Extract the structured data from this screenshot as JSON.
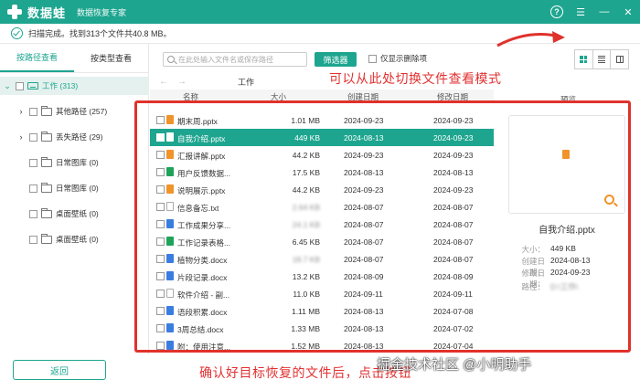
{
  "app": {
    "name": "数据蛙",
    "subtitle": "数据恢复专家"
  },
  "status": {
    "text": "扫描完成。找到313个文件共40.8 MB。"
  },
  "sidebar": {
    "tabs": [
      {
        "label": "按路径查看",
        "active": true
      },
      {
        "label": "按类型查看",
        "active": false
      }
    ],
    "root": {
      "label": "工作 (313)"
    },
    "items": [
      {
        "label": "其他路径 (257)",
        "expandable": true
      },
      {
        "label": "丢失路径 (29)",
        "expandable": true
      },
      {
        "label": "日常图库 (0)",
        "expandable": false
      },
      {
        "label": "日常图库 (0)",
        "expandable": false
      },
      {
        "label": "桌面壁纸 (0)",
        "expandable": false
      },
      {
        "label": "桌面壁纸 (0)",
        "expandable": false
      }
    ],
    "back_label": "返回"
  },
  "toolbar": {
    "search_placeholder": "在此处输入文件名或保存路径",
    "filter_label": "筛选器",
    "only_deleted_label": "仅显示删除项"
  },
  "annotations": {
    "top": "可以从此处切换文件查看模式",
    "bottom": "确认好目标恢复的文件后，点击按钮"
  },
  "watermark": "掘金技术社区 @小明助手",
  "breadcrumb": "工作",
  "columns": {
    "name": "名称",
    "size": "大小",
    "created": "创建日期",
    "modified": "修改日期"
  },
  "files": [
    {
      "name": "期末周.pptx",
      "size": "1.01 MB",
      "created": "2024-09-23",
      "modified": "2024-09-23",
      "type": "pptx",
      "selected": false
    },
    {
      "name": "自我介绍.pptx",
      "size": "449 KB",
      "created": "2024-08-13",
      "modified": "2024-09-23",
      "type": "pptx2",
      "selected": true
    },
    {
      "name": "汇报讲解.pptx",
      "size": "44.2 KB",
      "created": "2024-09-23",
      "modified": "2024-09-23",
      "type": "pptx",
      "selected": false
    },
    {
      "name": "用户反馈数据...",
      "size": "17.5 KB",
      "created": "2024-08-13",
      "modified": "2024-08-13",
      "type": "xlsx",
      "selected": false
    },
    {
      "name": "说明展示.pptx",
      "size": "44.2 KB",
      "created": "2024-09-23",
      "modified": "2024-09-23",
      "type": "pptx",
      "selected": false
    },
    {
      "name": "信息备忘.txt",
      "size": "",
      "created": "2024-08-07",
      "modified": "2024-08-07",
      "type": "txt",
      "selected": false
    },
    {
      "name": "工作成果分享...",
      "size": "",
      "created": "2024-08-07",
      "modified": "2024-08-07",
      "type": "docx",
      "selected": false
    },
    {
      "name": "工作记录表格...",
      "size": "6.45 KB",
      "created": "2024-08-07",
      "modified": "2024-08-07",
      "type": "xlsx",
      "selected": false
    },
    {
      "name": "植物分类.docx",
      "size": "",
      "created": "2024-08-07",
      "modified": "2024-08-07",
      "type": "docx",
      "selected": false
    },
    {
      "name": "片段记录.docx",
      "size": "13.2 KB",
      "created": "2024-08-09",
      "modified": "2024-08-09",
      "type": "docx",
      "selected": false
    },
    {
      "name": "软件介绍 - 副...",
      "size": "11.0 KB",
      "created": "2024-09-11",
      "modified": "2024-09-11",
      "type": "docx",
      "selected": false
    },
    {
      "name": "语段积累.docx",
      "size": "1.11 MB",
      "created": "2024-08-13",
      "modified": "2024-07-08",
      "type": "docx",
      "selected": false
    },
    {
      "name": "3周总结.docx",
      "size": "1.33 MB",
      "created": "2024-08-13",
      "modified": "2024-07-02",
      "type": "docx",
      "selected": false
    },
    {
      "name": "附：使用注意...",
      "size": "1.52 MB",
      "created": "2024-08-13",
      "modified": "2024-07-04",
      "type": "docx",
      "selected": false
    }
  ],
  "preview": {
    "label": "预览",
    "filename": "自我介绍.pptx",
    "size_key": "大小：",
    "size_val": "449 KB",
    "created_key": "创建日期：",
    "created_val": "2024-08-13",
    "modified_key": "修改日期：",
    "modified_val": "2024-09-23",
    "path_key": "路径："
  },
  "colors": {
    "accent": "#1ea58f",
    "annotation": "#e0322c",
    "pptx": "#f0932a",
    "xlsx": "#1fa35a",
    "docx": "#3a7de0"
  }
}
